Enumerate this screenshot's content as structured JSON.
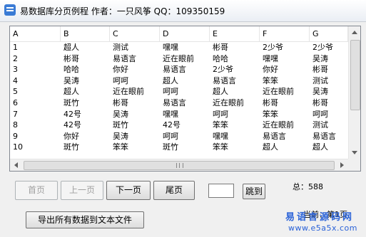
{
  "window": {
    "title": "易数据库分页例程   作者：一只风筝 QQ：109350159"
  },
  "table": {
    "columns": [
      "A",
      "B",
      "C",
      "D",
      "E",
      "F",
      "G"
    ],
    "rows": [
      [
        "1",
        "超人",
        "测试",
        "嘿嘿",
        "彬哥",
        "2少爷",
        "2少爷"
      ],
      [
        "2",
        "彬哥",
        "易语言",
        "近在眼前",
        "哈哈",
        "嘿嘿",
        "吴涛"
      ],
      [
        "3",
        "哈哈",
        "你好",
        "易语言",
        "2少爷",
        "你好",
        "彬哥"
      ],
      [
        "4",
        "吴涛",
        "呵呵",
        "超人",
        "易语言",
        "笨笨",
        "测试"
      ],
      [
        "5",
        "超人",
        "近在眼前",
        "呵呵",
        "超人",
        "近在眼前",
        "吴涛"
      ],
      [
        "6",
        "斑竹",
        "彬哥",
        "易语言",
        "近在眼前",
        "彬哥",
        "彬哥"
      ],
      [
        "7",
        "42号",
        "吴涛",
        "嘿嘿",
        "呵呵",
        "笨笨",
        "呵呵"
      ],
      [
        "8",
        "42号",
        "斑竹",
        "42号",
        "笨笨",
        "近在眼前",
        "测试"
      ],
      [
        "9",
        "你好",
        "吴涛",
        "呵呵",
        "嘿嘿",
        "易语言",
        "易语言"
      ],
      [
        "10",
        "斑竹",
        "笨笨",
        "斑竹",
        "笨笨",
        "超人",
        "超人"
      ]
    ]
  },
  "buttons": {
    "first": "首页",
    "prev": "上一页",
    "next": "下一页",
    "last": "尾页",
    "jump": "跳到",
    "export": "导出所有数据到文本文件"
  },
  "jump_input_value": "",
  "total_label": "总：588",
  "current_page_label": "当前：第1页",
  "watermark": {
    "cn": "易语言源码网",
    "en": "www.e5a5x.com"
  }
}
